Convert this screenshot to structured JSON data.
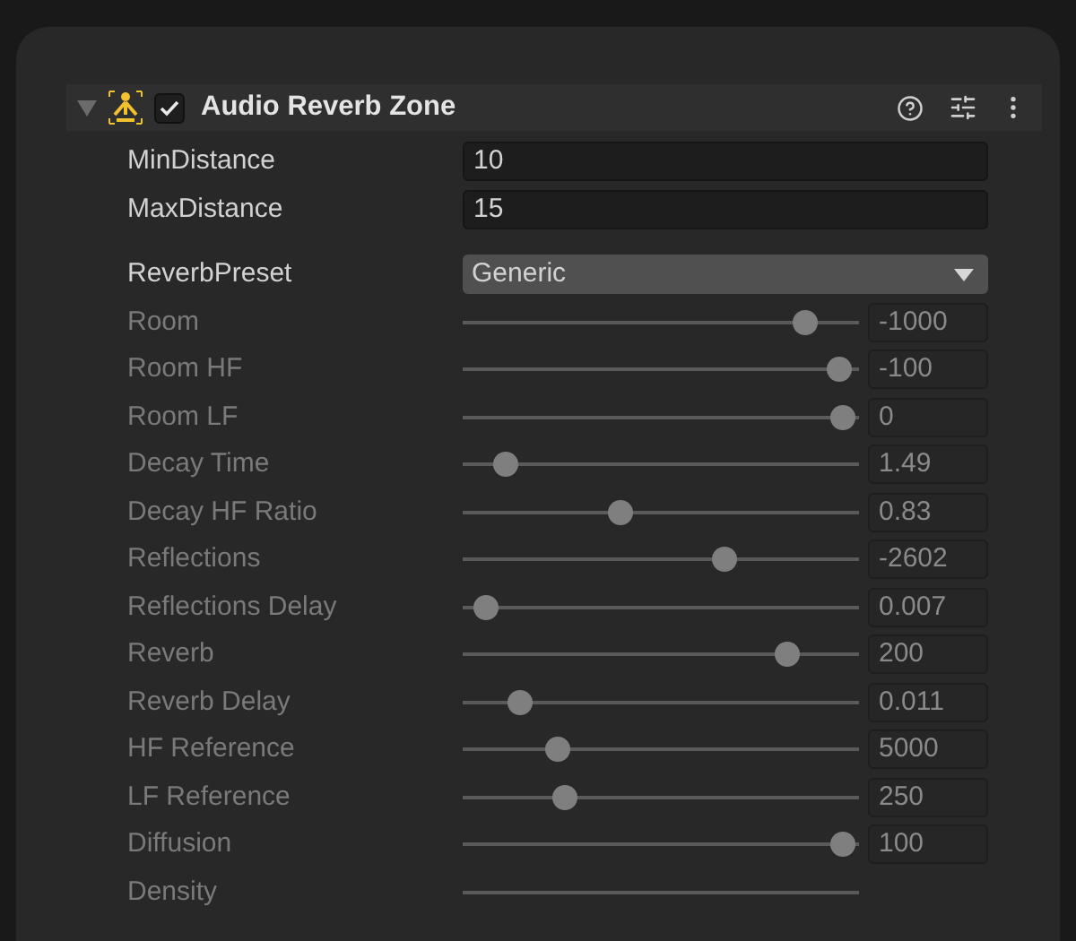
{
  "component": {
    "title": "Audio Reverb Zone",
    "expanded": true,
    "enabled": true
  },
  "fields": [
    {
      "kind": "number",
      "label": "MinDistance",
      "value": "10",
      "disabled": false
    },
    {
      "kind": "number",
      "label": "MaxDistance",
      "value": "15",
      "disabled": false
    },
    {
      "kind": "dropdown",
      "label": "ReverbPreset",
      "value": "Generic",
      "disabled": false
    },
    {
      "kind": "slider",
      "label": "Room",
      "value": "-1000",
      "level": 0.89,
      "disabled": true
    },
    {
      "kind": "slider",
      "label": "Room HF",
      "value": "-100",
      "level": 0.98,
      "disabled": true
    },
    {
      "kind": "slider",
      "label": "Room LF",
      "value": "0",
      "level": 0.99,
      "disabled": true
    },
    {
      "kind": "slider",
      "label": "Decay Time",
      "value": "1.49",
      "level": 0.08,
      "disabled": true
    },
    {
      "kind": "slider",
      "label": "Decay HF Ratio",
      "value": "0.83",
      "level": 0.39,
      "disabled": true
    },
    {
      "kind": "slider",
      "label": "Reflections",
      "value": "-2602",
      "level": 0.67,
      "disabled": true
    },
    {
      "kind": "slider",
      "label": "Reflections Delay",
      "value": "0.007",
      "level": 0.03,
      "disabled": true
    },
    {
      "kind": "slider",
      "label": "Reverb",
      "value": "200",
      "level": 0.84,
      "disabled": true
    },
    {
      "kind": "slider",
      "label": "Reverb Delay",
      "value": "0.011",
      "level": 0.12,
      "disabled": true
    },
    {
      "kind": "slider",
      "label": "HF Reference",
      "value": "5000",
      "level": 0.22,
      "disabled": true
    },
    {
      "kind": "slider",
      "label": "LF Reference",
      "value": "250",
      "level": 0.24,
      "disabled": true
    },
    {
      "kind": "slider",
      "label": "Diffusion",
      "value": "100",
      "level": 0.99,
      "disabled": true
    },
    {
      "kind": "slider",
      "label": "Density",
      "disabled": true
    }
  ]
}
